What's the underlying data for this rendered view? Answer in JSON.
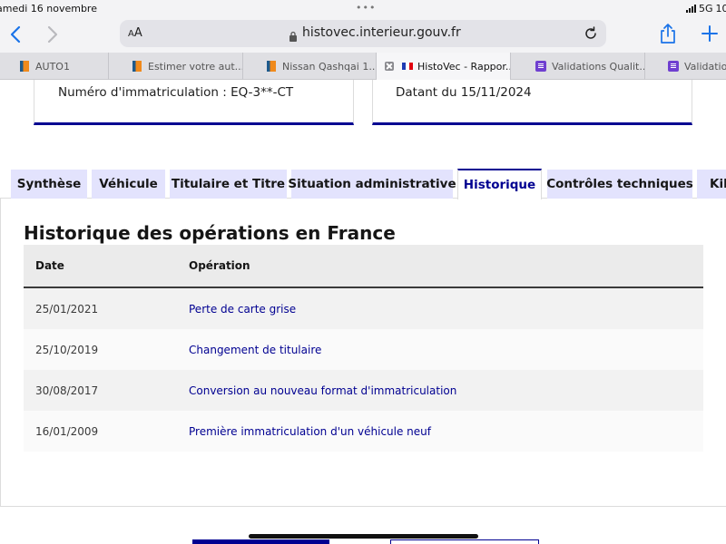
{
  "status_bar": {
    "date": "amedi 16 novembre",
    "network": "5G",
    "battery": "10"
  },
  "browser": {
    "text_size_label": "AA",
    "url": "histovec.interieur.gouv.fr",
    "tabs": [
      {
        "label": "AUTO1",
        "favicon": "auto1-logo-icon"
      },
      {
        "label": "Estimer votre aut...",
        "favicon": "auto1-logo-icon"
      },
      {
        "label": "Nissan Qashqai 1....",
        "favicon": "auto1-logo-icon"
      },
      {
        "label": "HistoVec - Rappor...",
        "favicon": "french-flag-icon",
        "active": true
      },
      {
        "label": "Validations Qualit...",
        "favicon": "list-icon"
      },
      {
        "label": "Validation",
        "favicon": "list-icon"
      }
    ]
  },
  "summary_cards": {
    "registration": "Numéro d'immatriculation : EQ-3**-CT",
    "date_label": "Datant du 15/11/2024"
  },
  "page_tabs": [
    {
      "label": "Synthèse"
    },
    {
      "label": "Véhicule"
    },
    {
      "label": "Titulaire et Titre"
    },
    {
      "label": "Situation administrative"
    },
    {
      "label": "Historique",
      "active": true
    },
    {
      "label": "Contrôles techniques"
    },
    {
      "label": "Kil"
    }
  ],
  "history": {
    "title": "Historique des opérations en France",
    "columns": {
      "date": "Date",
      "operation": "Opération"
    },
    "rows": [
      {
        "date": "25/01/2021",
        "operation": "Perte de carte grise"
      },
      {
        "date": "25/10/2019",
        "operation": "Changement de titulaire"
      },
      {
        "date": "30/08/2017",
        "operation": "Conversion au nouveau format d'immatriculation"
      },
      {
        "date": "16/01/2009",
        "operation": "Première immatriculation d'un véhicule neuf"
      }
    ]
  },
  "colors": {
    "accent": "#000091",
    "tab_background": "#e3e3fd"
  }
}
